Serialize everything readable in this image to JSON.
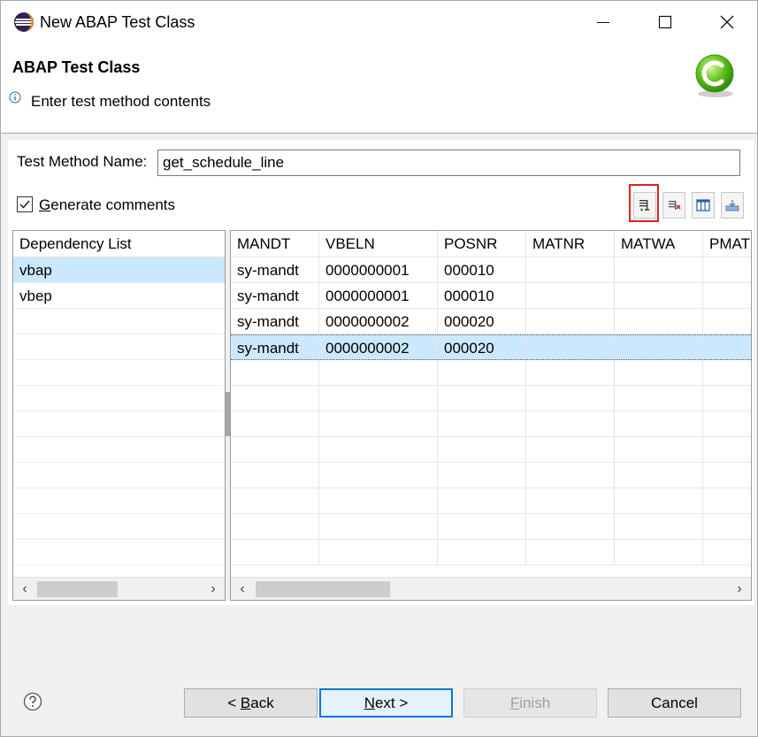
{
  "window": {
    "title": "New ABAP Test Class"
  },
  "banner": {
    "title": "ABAP Test Class",
    "message": "Enter test method contents"
  },
  "form": {
    "method_name_label": "Test Method Name:",
    "method_name_value": "get_schedule_line",
    "generate_comments_label": "Generate comments",
    "generate_comments_checked": true
  },
  "toolbar": {
    "icons": [
      "add-row-icon",
      "delete-row-icon",
      "columns-icon",
      "import-icon"
    ]
  },
  "dependency_list": {
    "header": "Dependency List",
    "items": [
      "vbap",
      "vbep"
    ],
    "selected_index": 0
  },
  "table": {
    "columns": [
      "MANDT",
      "VBELN",
      "POSNR",
      "MATNR",
      "MATWA",
      "PMAT"
    ],
    "rows": [
      [
        "sy-mandt",
        "0000000001",
        "000010",
        "",
        "",
        ""
      ],
      [
        "sy-mandt",
        "0000000001",
        "000010",
        "",
        "",
        ""
      ],
      [
        "sy-mandt",
        "0000000002",
        "000020",
        "",
        "",
        ""
      ],
      [
        "sy-mandt",
        "0000000002",
        "000020",
        "",
        "",
        ""
      ]
    ],
    "selected_row": 3
  },
  "buttons": {
    "back": {
      "prefix": "< ",
      "mnemonic": "B",
      "rest": "ack"
    },
    "next": {
      "mnemonic": "N",
      "rest": "ext >"
    },
    "finish": {
      "mnemonic": "F",
      "rest": "inish"
    },
    "cancel": "Cancel"
  },
  "colors": {
    "selection": "#cce8ff",
    "default_button_border": "#0078d7",
    "highlight_red": "#e02020"
  }
}
